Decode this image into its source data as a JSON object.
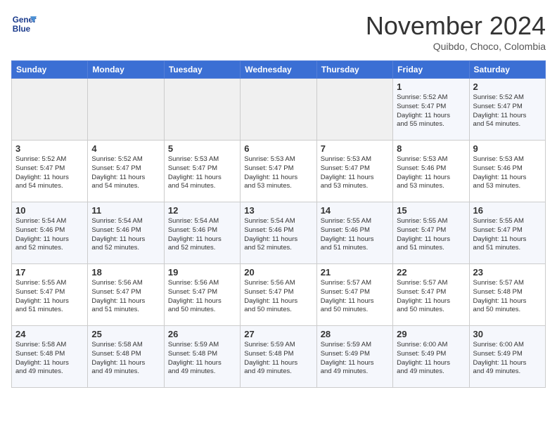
{
  "header": {
    "logo_line1": "General",
    "logo_line2": "Blue",
    "month": "November 2024",
    "location": "Quibdo, Choco, Colombia"
  },
  "weekdays": [
    "Sunday",
    "Monday",
    "Tuesday",
    "Wednesday",
    "Thursday",
    "Friday",
    "Saturday"
  ],
  "weeks": [
    [
      {
        "day": "",
        "info": ""
      },
      {
        "day": "",
        "info": ""
      },
      {
        "day": "",
        "info": ""
      },
      {
        "day": "",
        "info": ""
      },
      {
        "day": "",
        "info": ""
      },
      {
        "day": "1",
        "info": "Sunrise: 5:52 AM\nSunset: 5:47 PM\nDaylight: 11 hours\nand 55 minutes."
      },
      {
        "day": "2",
        "info": "Sunrise: 5:52 AM\nSunset: 5:47 PM\nDaylight: 11 hours\nand 54 minutes."
      }
    ],
    [
      {
        "day": "3",
        "info": "Sunrise: 5:52 AM\nSunset: 5:47 PM\nDaylight: 11 hours\nand 54 minutes."
      },
      {
        "day": "4",
        "info": "Sunrise: 5:52 AM\nSunset: 5:47 PM\nDaylight: 11 hours\nand 54 minutes."
      },
      {
        "day": "5",
        "info": "Sunrise: 5:53 AM\nSunset: 5:47 PM\nDaylight: 11 hours\nand 54 minutes."
      },
      {
        "day": "6",
        "info": "Sunrise: 5:53 AM\nSunset: 5:47 PM\nDaylight: 11 hours\nand 53 minutes."
      },
      {
        "day": "7",
        "info": "Sunrise: 5:53 AM\nSunset: 5:47 PM\nDaylight: 11 hours\nand 53 minutes."
      },
      {
        "day": "8",
        "info": "Sunrise: 5:53 AM\nSunset: 5:46 PM\nDaylight: 11 hours\nand 53 minutes."
      },
      {
        "day": "9",
        "info": "Sunrise: 5:53 AM\nSunset: 5:46 PM\nDaylight: 11 hours\nand 53 minutes."
      }
    ],
    [
      {
        "day": "10",
        "info": "Sunrise: 5:54 AM\nSunset: 5:46 PM\nDaylight: 11 hours\nand 52 minutes."
      },
      {
        "day": "11",
        "info": "Sunrise: 5:54 AM\nSunset: 5:46 PM\nDaylight: 11 hours\nand 52 minutes."
      },
      {
        "day": "12",
        "info": "Sunrise: 5:54 AM\nSunset: 5:46 PM\nDaylight: 11 hours\nand 52 minutes."
      },
      {
        "day": "13",
        "info": "Sunrise: 5:54 AM\nSunset: 5:46 PM\nDaylight: 11 hours\nand 52 minutes."
      },
      {
        "day": "14",
        "info": "Sunrise: 5:55 AM\nSunset: 5:46 PM\nDaylight: 11 hours\nand 51 minutes."
      },
      {
        "day": "15",
        "info": "Sunrise: 5:55 AM\nSunset: 5:47 PM\nDaylight: 11 hours\nand 51 minutes."
      },
      {
        "day": "16",
        "info": "Sunrise: 5:55 AM\nSunset: 5:47 PM\nDaylight: 11 hours\nand 51 minutes."
      }
    ],
    [
      {
        "day": "17",
        "info": "Sunrise: 5:55 AM\nSunset: 5:47 PM\nDaylight: 11 hours\nand 51 minutes."
      },
      {
        "day": "18",
        "info": "Sunrise: 5:56 AM\nSunset: 5:47 PM\nDaylight: 11 hours\nand 51 minutes."
      },
      {
        "day": "19",
        "info": "Sunrise: 5:56 AM\nSunset: 5:47 PM\nDaylight: 11 hours\nand 50 minutes."
      },
      {
        "day": "20",
        "info": "Sunrise: 5:56 AM\nSunset: 5:47 PM\nDaylight: 11 hours\nand 50 minutes."
      },
      {
        "day": "21",
        "info": "Sunrise: 5:57 AM\nSunset: 5:47 PM\nDaylight: 11 hours\nand 50 minutes."
      },
      {
        "day": "22",
        "info": "Sunrise: 5:57 AM\nSunset: 5:47 PM\nDaylight: 11 hours\nand 50 minutes."
      },
      {
        "day": "23",
        "info": "Sunrise: 5:57 AM\nSunset: 5:48 PM\nDaylight: 11 hours\nand 50 minutes."
      }
    ],
    [
      {
        "day": "24",
        "info": "Sunrise: 5:58 AM\nSunset: 5:48 PM\nDaylight: 11 hours\nand 49 minutes."
      },
      {
        "day": "25",
        "info": "Sunrise: 5:58 AM\nSunset: 5:48 PM\nDaylight: 11 hours\nand 49 minutes."
      },
      {
        "day": "26",
        "info": "Sunrise: 5:59 AM\nSunset: 5:48 PM\nDaylight: 11 hours\nand 49 minutes."
      },
      {
        "day": "27",
        "info": "Sunrise: 5:59 AM\nSunset: 5:48 PM\nDaylight: 11 hours\nand 49 minutes."
      },
      {
        "day": "28",
        "info": "Sunrise: 5:59 AM\nSunset: 5:49 PM\nDaylight: 11 hours\nand 49 minutes."
      },
      {
        "day": "29",
        "info": "Sunrise: 6:00 AM\nSunset: 5:49 PM\nDaylight: 11 hours\nand 49 minutes."
      },
      {
        "day": "30",
        "info": "Sunrise: 6:00 AM\nSunset: 5:49 PM\nDaylight: 11 hours\nand 49 minutes."
      }
    ]
  ]
}
